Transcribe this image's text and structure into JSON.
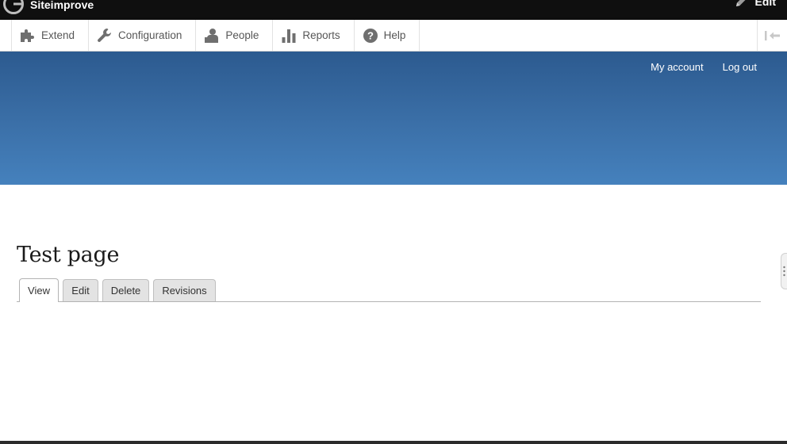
{
  "toolbar": {
    "brand": "Siteimprove",
    "edit_label": "Edit"
  },
  "admin_menu": {
    "items": [
      {
        "label": "Extend",
        "icon": "puzzle-icon"
      },
      {
        "label": "Configuration",
        "icon": "wrench-icon"
      },
      {
        "label": "People",
        "icon": "people-icon"
      },
      {
        "label": "Reports",
        "icon": "bar-chart-icon"
      },
      {
        "label": "Help",
        "icon": "question-icon"
      }
    ],
    "toggle_icon": "collapse-tray-icon"
  },
  "header": {
    "links": [
      "My account",
      "Log out"
    ],
    "gradient": [
      "#2c5a8f",
      "#4581bd"
    ]
  },
  "page": {
    "title": "Test page",
    "tabs": [
      "View",
      "Edit",
      "Delete",
      "Revisions"
    ],
    "active_tab": "View"
  }
}
